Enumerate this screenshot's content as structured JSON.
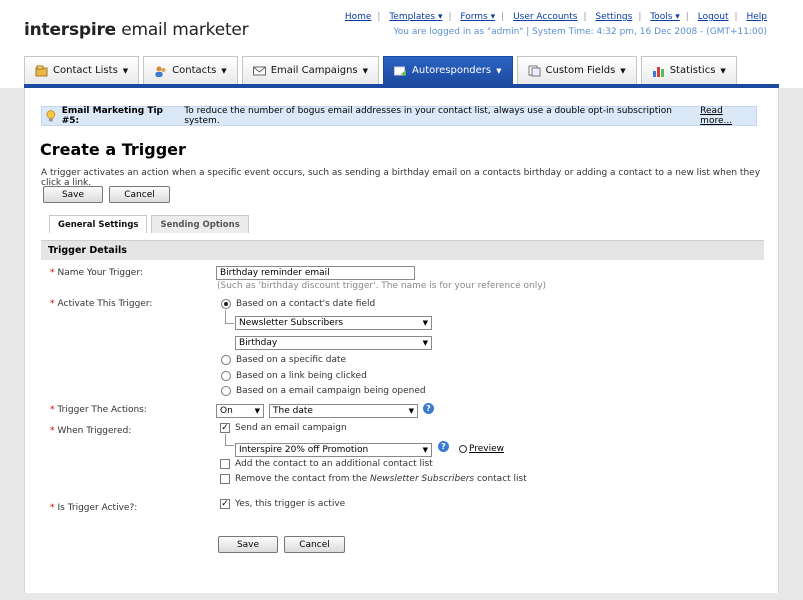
{
  "app": {
    "logo_bold": "interspire",
    "logo_rest": " email marketer",
    "status": "You are logged in as \"admin\" | System Time: 4:32 pm, 16 Dec 2008 - (GMT+11:00)"
  },
  "toplinks": [
    "Home",
    "Templates ▾",
    "Forms ▾",
    "User Accounts",
    "Settings",
    "Tools ▾",
    "Logout",
    "Help"
  ],
  "tabs": [
    {
      "label": "Contact Lists",
      "icon": "contact-lists-icon"
    },
    {
      "label": "Contacts",
      "icon": "contacts-icon"
    },
    {
      "label": "Email Campaigns",
      "icon": "envelope-icon"
    },
    {
      "label": "Autoresponders",
      "icon": "autoresponder-icon",
      "active": true
    },
    {
      "label": "Custom Fields",
      "icon": "custom-fields-icon"
    },
    {
      "label": "Statistics",
      "icon": "statistics-icon"
    }
  ],
  "tip": {
    "title": "Email Marketing Tip #5:",
    "text": "To reduce the number of bogus email addresses in your contact list, always use a double opt-in subscription system.",
    "link": "Read more..."
  },
  "page": {
    "title": "Create a Trigger",
    "intro": "A trigger activates an action when a specific event occurs, such as sending a birthday email on a contacts birthday or adding a contact to a new list when they click a link.",
    "save": "Save",
    "cancel": "Cancel"
  },
  "subtabs": [
    "General Settings",
    "Sending Options"
  ],
  "section": "Trigger Details",
  "form": {
    "name_label": "Name Your Trigger:",
    "name_value": "Birthday reminder email",
    "name_hint": "(Such as 'birthday discount trigger'. The name is for your reference only)",
    "activate_label": "Activate This Trigger:",
    "activate_opt1": "Based on a contact's date field",
    "list_select": "Newsletter Subscribers",
    "field_select": "Birthday",
    "activate_opt2": "Based on a specific date",
    "activate_opt3": "Based on a link being clicked",
    "activate_opt4": "Based on a email campaign being opened",
    "actions_label": "Trigger The Actions:",
    "actions_when": "On",
    "actions_date": "The date",
    "when_label": "When Triggered:",
    "send_campaign": "Send an email campaign",
    "campaign_select": "Interspire 20% off Promotion",
    "preview": "Preview",
    "add_contact": "Add the contact to an additional contact list",
    "remove_prefix": "Remove the contact from the ",
    "remove_list": "Newsletter Subscribers",
    "remove_suffix": " contact list",
    "active_label": "Is Trigger Active?:",
    "active_text": "Yes, this trigger is active",
    "check_mark": "✓",
    "help_glyph": "?"
  }
}
